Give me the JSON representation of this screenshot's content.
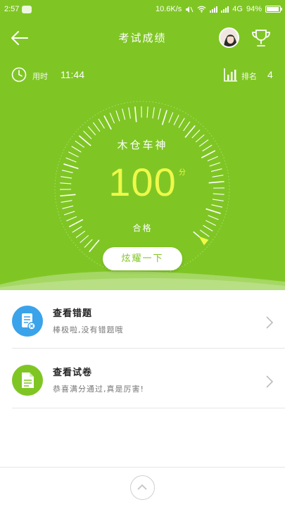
{
  "status_bar": {
    "time": "2:57",
    "speed": "10.6K/s",
    "network": "4G",
    "battery_percent": "94%",
    "battery_level": 0.94
  },
  "header": {
    "title": "考试成绩"
  },
  "info": {
    "time_label": "用时",
    "time_value": "11:44",
    "rank_label": "排名",
    "rank_value": "4"
  },
  "gauge": {
    "title": "木仓车神",
    "score": "100",
    "unit": "分",
    "status": "合格",
    "score_fraction": 1.0
  },
  "flaunt_button": {
    "label": "炫耀一下"
  },
  "menu": [
    {
      "title": "查看错题",
      "subtitle": "棒极啦,没有错题哦",
      "icon": "wrong-questions-icon",
      "color": "#3aa3ea"
    },
    {
      "title": "查看试卷",
      "subtitle": "恭喜满分通过,真是厉害!",
      "icon": "exam-paper-icon",
      "color": "#7fc624"
    }
  ],
  "colors": {
    "brand_green": "#7fc624",
    "score_yellow": "#eef94a",
    "blue": "#3aa3ea"
  }
}
